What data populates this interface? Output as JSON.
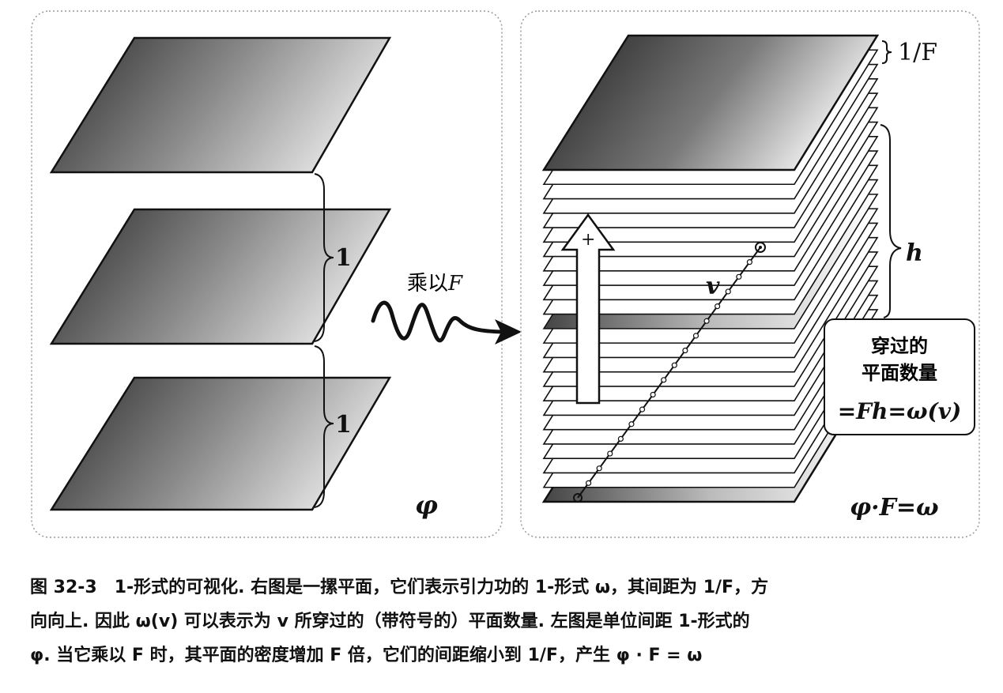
{
  "left_panel": {
    "spacing_labels": [
      "1",
      "1"
    ],
    "form_label": "φ"
  },
  "arrow": {
    "label_prefix": "乘以",
    "label_var": "F"
  },
  "right_panel": {
    "spacing_label": "1/F",
    "height_label": "h",
    "plus_sign": "+",
    "vector_label": "v",
    "box_lines": [
      "穿过的",
      "平面数量"
    ],
    "box_formula": "=Fh=ω(v)",
    "form_label": "φ·F=ω"
  },
  "caption": {
    "lines": [
      "图 32-3　1-形式的可视化. 右图是一摞平面，它们表示引力功的 1-形式 ω，其间距为 1/F，方",
      "向向上. 因此 ω(v) 可以表示为 v 所穿过的（带符号的）平面数量. 左图是单位间距 1-形式的",
      "φ. 当它乘以 F 时，其平面的密度增加 F 倍，它们的间距缩小到 1/F，产生 φ · F = ω"
    ]
  }
}
